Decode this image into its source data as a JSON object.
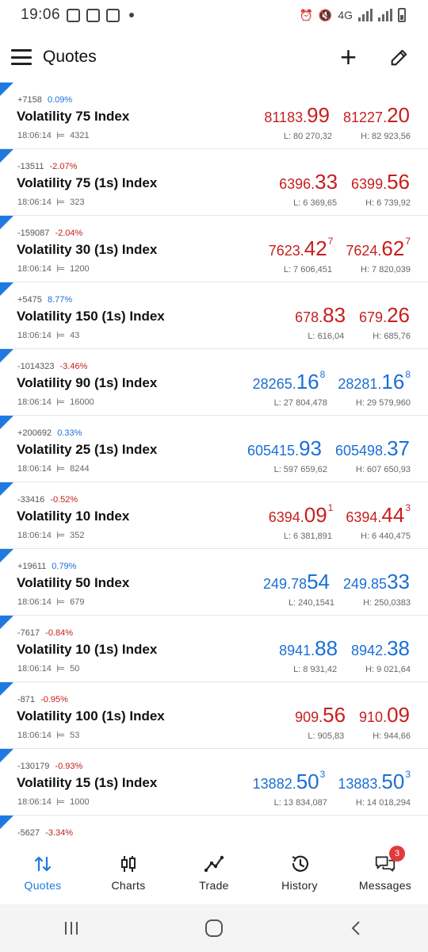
{
  "status_bar": {
    "time": "19:06",
    "network": "4G"
  },
  "app_bar": {
    "title": "Quotes"
  },
  "quotes": [
    {
      "change": "+7158",
      "pct": "0.09%",
      "pct_dir": "up",
      "symbol": "Volatility 75 Index",
      "time": "18:06:14",
      "spread": "4321",
      "bid_main": "81183.",
      "bid_big": "99",
      "bid_sup": "",
      "ask_main": "81227.",
      "ask_big": "20",
      "ask_sup": "",
      "color": "red",
      "low": "L: 80 270,32",
      "high": "H: 82 923,56"
    },
    {
      "change": "-13511",
      "pct": "-2.07%",
      "pct_dir": "down",
      "symbol": "Volatility 75 (1s) Index",
      "time": "18:06:14",
      "spread": "323",
      "bid_main": "6396.",
      "bid_big": "33",
      "bid_sup": "",
      "ask_main": "6399.",
      "ask_big": "56",
      "ask_sup": "",
      "color": "red",
      "low": "L: 6 369,65",
      "high": "H: 6 739,92"
    },
    {
      "change": "-159087",
      "pct": "-2.04%",
      "pct_dir": "down",
      "symbol": "Volatility 30 (1s) Index",
      "time": "18:06:14",
      "spread": "1200",
      "bid_main": "7623.",
      "bid_big": "42",
      "bid_sup": "7",
      "ask_main": "7624.",
      "ask_big": "62",
      "ask_sup": "7",
      "color": "red",
      "low": "L: 7 606,451",
      "high": "H: 7 820,039"
    },
    {
      "change": "+5475",
      "pct": "8.77%",
      "pct_dir": "up",
      "symbol": "Volatility 150 (1s) Index",
      "time": "18:06:14",
      "spread": "43",
      "bid_main": "678.",
      "bid_big": "83",
      "bid_sup": "",
      "ask_main": "679.",
      "ask_big": "26",
      "ask_sup": "",
      "color": "red",
      "low": "L: 616,04",
      "high": "H: 685,76"
    },
    {
      "change": "-1014323",
      "pct": "-3.46%",
      "pct_dir": "down",
      "symbol": "Volatility 90 (1s) Index",
      "time": "18:06:14",
      "spread": "16000",
      "bid_main": "28265.",
      "bid_big": "16",
      "bid_sup": "8",
      "ask_main": "28281.",
      "ask_big": "16",
      "ask_sup": "8",
      "color": "blue",
      "low": "L: 27 804,478",
      "high": "H: 29 579,960"
    },
    {
      "change": "+200692",
      "pct": "0.33%",
      "pct_dir": "up",
      "symbol": "Volatility 25 (1s) Index",
      "time": "18:06:14",
      "spread": "8244",
      "bid_main": "605415.",
      "bid_big": "93",
      "bid_sup": "",
      "ask_main": "605498.",
      "ask_big": "37",
      "ask_sup": "",
      "color": "blue",
      "low": "L: 597 659,62",
      "high": "H: 607 650,93"
    },
    {
      "change": "-33416",
      "pct": "-0.52%",
      "pct_dir": "down",
      "symbol": "Volatility 10 Index",
      "time": "18:06:14",
      "spread": "352",
      "bid_main": "6394.",
      "bid_big": "09",
      "bid_sup": "1",
      "ask_main": "6394.",
      "ask_big": "44",
      "ask_sup": "3",
      "color": "red",
      "low": "L: 6 381,891",
      "high": "H: 6 440,475"
    },
    {
      "change": "+19611",
      "pct": "0.79%",
      "pct_dir": "up",
      "symbol": "Volatility 50 Index",
      "time": "18:06:14",
      "spread": "679",
      "bid_main": "249.78",
      "bid_big": "54",
      "bid_sup": "",
      "ask_main": "249.85",
      "ask_big": "33",
      "ask_sup": "",
      "color": "blue",
      "low": "L: 240,1541",
      "high": "H: 250,0383"
    },
    {
      "change": "-7617",
      "pct": "-0.84%",
      "pct_dir": "down",
      "symbol": "Volatility 10 (1s) Index",
      "time": "18:06:14",
      "spread": "50",
      "bid_main": "8941.",
      "bid_big": "88",
      "bid_sup": "",
      "ask_main": "8942.",
      "ask_big": "38",
      "ask_sup": "",
      "color": "blue",
      "low": "L: 8 931,42",
      "high": "H: 9 021,64"
    },
    {
      "change": "-871",
      "pct": "-0.95%",
      "pct_dir": "down",
      "symbol": "Volatility 100 (1s) Index",
      "time": "18:06:14",
      "spread": "53",
      "bid_main": "909.",
      "bid_big": "56",
      "bid_sup": "",
      "ask_main": "910.",
      "ask_big": "09",
      "ask_sup": "",
      "color": "red",
      "low": "L: 905,83",
      "high": "H: 944,66"
    },
    {
      "change": "-130179",
      "pct": "-0.93%",
      "pct_dir": "down",
      "symbol": "Volatility 15 (1s) Index",
      "time": "18:06:14",
      "spread": "1000",
      "bid_main": "13882.",
      "bid_big": "50",
      "bid_sup": "3",
      "ask_main": "13883.",
      "ask_big": "50",
      "ask_sup": "3",
      "color": "blue",
      "low": "L: 13 834,087",
      "high": "H: 14 018,294"
    }
  ],
  "partial_quote": {
    "change": "-5627",
    "pct": "-3.34%"
  },
  "bottom_nav": {
    "quotes": "Quotes",
    "charts": "Charts",
    "trade": "Trade",
    "history": "History",
    "messages": "Messages",
    "messages_badge": "3"
  },
  "colors": {
    "accent": "#1e7ae0",
    "price_red": "#c81e1e",
    "price_blue": "#1b6fd6",
    "badge": "#e03b3b"
  },
  "icons": [
    "menu-icon",
    "plus-icon",
    "pencil-icon",
    "quotes-icon",
    "charts-icon",
    "trade-icon",
    "history-icon",
    "messages-icon",
    "spread-icon"
  ]
}
